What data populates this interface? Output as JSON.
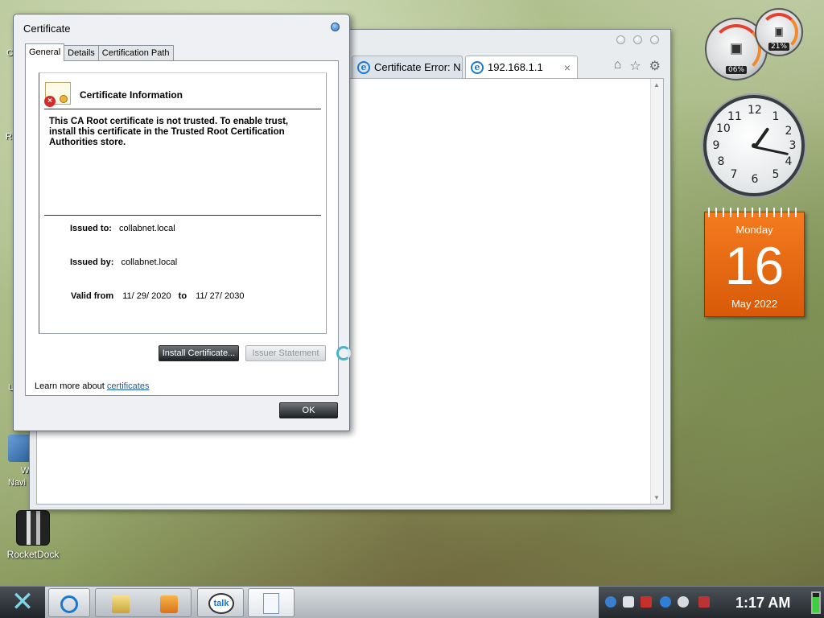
{
  "desktop": {
    "rocketdock_label": "RocketDock",
    "fragments": [
      "C",
      "R",
      "U",
      "W",
      "Navi"
    ]
  },
  "browser": {
    "tabs": [
      {
        "title": "Certificate Error: N...",
        "icon": "ie-icon"
      },
      {
        "title": "192.168.1.1",
        "icon": "ie-icon",
        "close": "×"
      }
    ],
    "nav_icons": [
      "home-icon",
      "star-icon",
      "gear-icon"
    ]
  },
  "certificate_dialog": {
    "title": "Certificate",
    "tabs": [
      "General",
      "Details",
      "Certification Path"
    ],
    "info_title": "Certificate Information",
    "message": "This CA Root certificate is not trusted. To enable trust, install this certificate in the Trusted Root Certification Authorities store.",
    "issued_to_label": "Issued to:",
    "issued_to": "collabnet.local",
    "issued_by_label": "Issued by:",
    "issued_by": "collabnet.local",
    "valid_from_label": "Valid from",
    "valid_from": "11/ 29/ 2020",
    "to_label": "to",
    "valid_to": "11/ 27/ 2030",
    "install_button": "Install Certificate...",
    "issuer_button": "Issuer Statement",
    "learn_more_text": "Learn more about",
    "learn_more_link": "certificates",
    "ok_button": "OK"
  },
  "gadgets": {
    "cpu_percent": "06%",
    "mem_percent": "21%",
    "calendar": {
      "day": "Monday",
      "date": "16",
      "month": "May 2022"
    },
    "clock_numbers": [
      "12",
      "1",
      "2",
      "3",
      "4",
      "5",
      "6",
      "7",
      "8",
      "9",
      "10",
      "11"
    ]
  },
  "taskbar": {
    "items": [
      "ie-icon",
      "folder-icon",
      "media-player-icon",
      "talk-icon",
      "document-icon"
    ],
    "talk_label": "talk",
    "time": "1:17 AM"
  },
  "colors": {
    "accent": "#1a78d0",
    "calendar": "#f47a1f",
    "link": "#1c5cae"
  }
}
